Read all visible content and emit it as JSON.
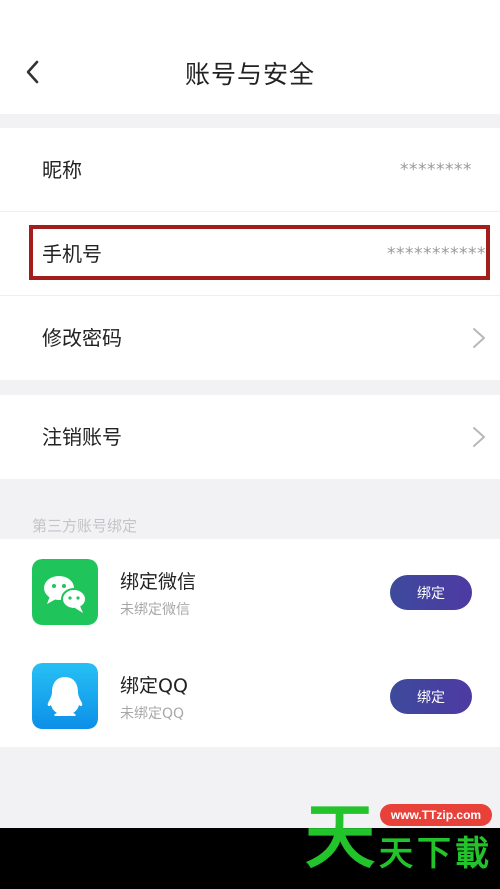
{
  "header": {
    "title": "账号与安全"
  },
  "account": {
    "nickname_label": "昵称",
    "nickname_value": "********",
    "phone_label": "手机号",
    "phone_value": "***********",
    "change_password_label": "修改密码"
  },
  "cancel": {
    "label": "注销账号"
  },
  "third_party": {
    "section_title": "第三方账号绑定",
    "items": [
      {
        "title": "绑定微信",
        "status": "未绑定微信",
        "button_label": "绑定",
        "icon": "wechat-icon",
        "color": "#1fc55a"
      },
      {
        "title": "绑定QQ",
        "status": "未绑定QQ",
        "button_label": "绑定",
        "icon": "qq-icon",
        "color": "#13a9f2"
      }
    ]
  },
  "watermark": {
    "url": "www.TTzip.com",
    "brand_chars": [
      "天",
      "天",
      "下",
      "載"
    ]
  },
  "colors": {
    "highlight_border": "#a31d1d",
    "button_gradient_start": "#3d4a9c",
    "button_gradient_end": "#4e3aa3"
  }
}
